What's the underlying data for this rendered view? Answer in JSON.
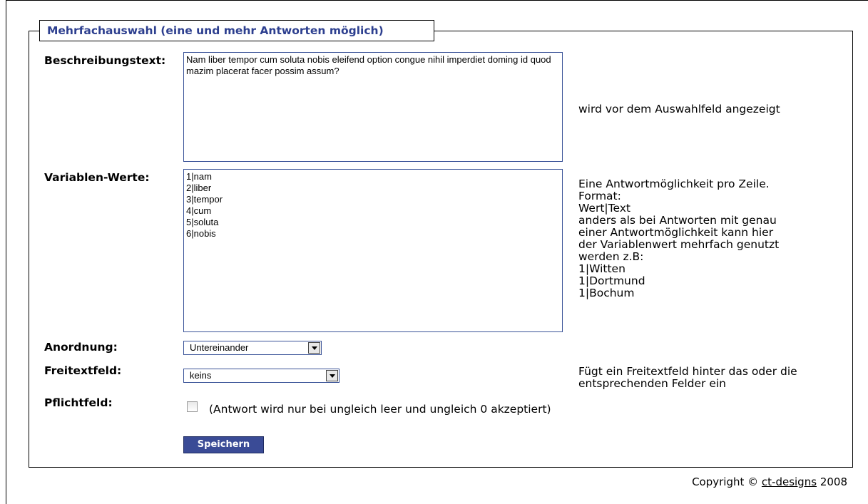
{
  "section": {
    "legend": "Mehrfachauswahl (eine und mehr Antworten möglich)"
  },
  "fields": {
    "beschreibung": {
      "label": "Beschreibungstext:",
      "value": "Nam liber tempor cum soluta nobis eleifend option congue nihil imperdiet doming id quod mazim placerat facer possim assum?",
      "hint": "wird vor dem Auswahlfeld angezeigt"
    },
    "variablen": {
      "label": "Variablen-Werte:",
      "value": "1|nam\n2|liber\n3|tempor\n4|cum\n5|soluta\n6|nobis",
      "hint_lines": [
        "Eine Antwortmöglichkeit pro Zeile.",
        "Format:",
        "Wert|Text",
        "anders als bei Antworten mit genau",
        "einer Antwortmöglichkeit kann hier",
        "der Variablenwert mehrfach genutzt",
        "werden z.B:",
        "1|Witten",
        "1|Dortmund",
        "1|Bochum"
      ]
    },
    "anordnung": {
      "label": "Anordnung:",
      "selected": "Untereinander"
    },
    "freitext": {
      "label": "Freitextfeld:",
      "selected": "keins",
      "hint": "Fügt ein Freitextfeld hinter das oder die entsprechenden Felder ein"
    },
    "pflicht": {
      "label": "Pflichtfeld:",
      "checked": false,
      "note": "(Antwort wird nur bei ungleich leer und ungleich 0 akzeptiert)"
    }
  },
  "actions": {
    "save_label": "Speichern"
  },
  "footer": {
    "prefix": "Copyright ©",
    "link_text": "ct-designs",
    "year": "2008"
  },
  "colors": {
    "accent": "#2d3f8f",
    "button": "#3a4b96",
    "input_border": "#3a5398"
  }
}
